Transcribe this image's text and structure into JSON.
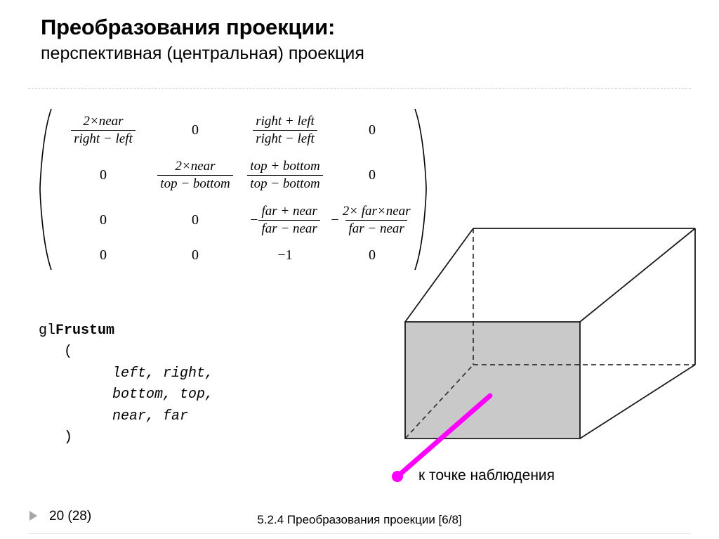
{
  "slide": {
    "title_main": "Преобразования проекции:",
    "title_sub": "перспективная (центральная) проекция"
  },
  "matrix": {
    "rows": [
      [
        {
          "type": "fraction",
          "numerator": "2×near",
          "denominator": "right − left",
          "negative": false
        },
        {
          "type": "number",
          "value": "0"
        },
        {
          "type": "fraction",
          "numerator": "right + left",
          "denominator": "right − left",
          "negative": false
        },
        {
          "type": "number",
          "value": "0"
        }
      ],
      [
        {
          "type": "number",
          "value": "0"
        },
        {
          "type": "fraction",
          "numerator": "2×near",
          "denominator": "top − bottom",
          "negative": false
        },
        {
          "type": "fraction",
          "numerator": "top + bottom",
          "denominator": "top − bottom",
          "negative": false
        },
        {
          "type": "number",
          "value": "0"
        }
      ],
      [
        {
          "type": "number",
          "value": "0"
        },
        {
          "type": "number",
          "value": "0"
        },
        {
          "type": "fraction",
          "numerator": "far + near",
          "denominator": "far − near",
          "negative": true
        },
        {
          "type": "fraction",
          "numerator": "2× far×near",
          "denominator": "far − near",
          "negative": true
        }
      ],
      [
        {
          "type": "number",
          "value": "0"
        },
        {
          "type": "number",
          "value": "0"
        },
        {
          "type": "number",
          "value": "−1"
        },
        {
          "type": "number",
          "value": "0"
        }
      ]
    ]
  },
  "code": {
    "fn_prefix": "gl",
    "fn_name": "Frustum",
    "open_paren": "(",
    "args_line1": "left, right,",
    "args_line2": "bottom, top,",
    "args_line3": "near, far",
    "close_paren": ")"
  },
  "figure": {
    "label": "к точке наблюдения",
    "near_plane_fill": "#c9c9c9",
    "edge_color": "#1a1a1a",
    "ray_color": "#ff00ff"
  },
  "footer": {
    "page": "20 (28)",
    "center": "5.2.4 Преобразования проекции  [6/8]"
  }
}
